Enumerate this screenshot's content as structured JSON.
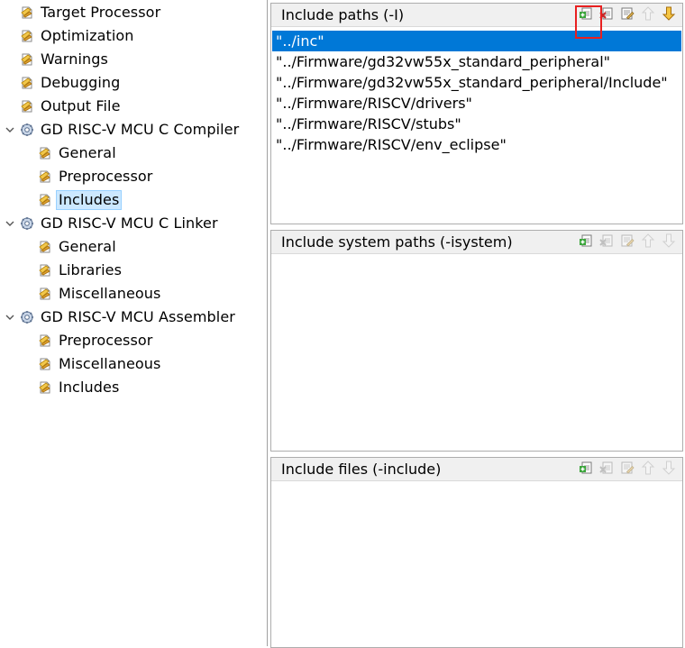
{
  "tree": {
    "items": [
      {
        "label": "Target Processor",
        "level": 1,
        "icon": "settings-page-icon"
      },
      {
        "label": "Optimization",
        "level": 1,
        "icon": "settings-page-icon"
      },
      {
        "label": "Warnings",
        "level": 1,
        "icon": "settings-page-icon"
      },
      {
        "label": "Debugging",
        "level": 1,
        "icon": "settings-page-icon"
      },
      {
        "label": "Output File",
        "level": 1,
        "icon": "settings-page-icon"
      },
      {
        "label": "GD RISC-V MCU C Compiler",
        "level": 0,
        "icon": "tool-gear-icon",
        "expanded": true
      },
      {
        "label": "General",
        "level": 2,
        "icon": "settings-page-icon"
      },
      {
        "label": "Preprocessor",
        "level": 2,
        "icon": "settings-page-icon"
      },
      {
        "label": "Includes",
        "level": 2,
        "icon": "settings-page-icon",
        "selected": true
      },
      {
        "label": "GD RISC-V MCU C Linker",
        "level": 0,
        "icon": "tool-gear-icon",
        "expanded": true
      },
      {
        "label": "General",
        "level": 2,
        "icon": "settings-page-icon"
      },
      {
        "label": "Libraries",
        "level": 2,
        "icon": "settings-page-icon"
      },
      {
        "label": "Miscellaneous",
        "level": 2,
        "icon": "settings-page-icon"
      },
      {
        "label": "GD RISC-V MCU Assembler",
        "level": 0,
        "icon": "tool-gear-icon",
        "expanded": true
      },
      {
        "label": "Preprocessor",
        "level": 2,
        "icon": "settings-page-icon"
      },
      {
        "label": "Miscellaneous",
        "level": 2,
        "icon": "settings-page-icon"
      },
      {
        "label": "Includes",
        "level": 2,
        "icon": "settings-page-icon"
      }
    ]
  },
  "panels": [
    {
      "title": "Include paths (-I)",
      "items": [
        "\"../inc\"",
        "\"../Firmware/gd32vw55x_standard_peripheral\"",
        "\"../Firmware/gd32vw55x_standard_peripheral/Include\"",
        "\"../Firmware/RISCV/drivers\"",
        "\"../Firmware/RISCV/stubs\"",
        "\"../Firmware/RISCV/env_eclipse\""
      ],
      "selected_index": 0,
      "toolbar": [
        "add-icon",
        "delete-icon",
        "edit-icon",
        "move-up-icon",
        "move-down-icon"
      ],
      "toolbar_enabled": [
        true,
        true,
        true,
        false,
        true
      ]
    },
    {
      "title": "Include system paths (-isystem)",
      "items": [],
      "toolbar": [
        "add-icon",
        "delete-icon",
        "edit-icon",
        "move-up-icon",
        "move-down-icon"
      ],
      "toolbar_enabled": [
        true,
        false,
        false,
        false,
        false
      ]
    },
    {
      "title": "Include files (-include)",
      "items": [],
      "toolbar": [
        "add-icon",
        "delete-icon",
        "edit-icon",
        "move-up-icon",
        "move-down-icon"
      ],
      "toolbar_enabled": [
        true,
        false,
        false,
        false,
        false
      ]
    }
  ],
  "colors": {
    "selection_blue": "#0078d7",
    "tree_selection": "#cce8ff",
    "highlight_red": "#e82020"
  }
}
